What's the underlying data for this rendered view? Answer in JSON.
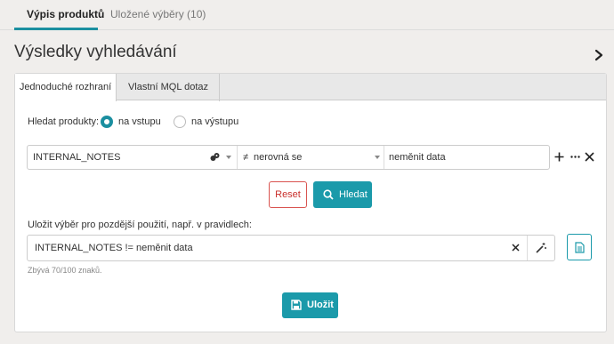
{
  "top_tabs": [
    {
      "label": "Výpis produktů",
      "active": true
    },
    {
      "label": "Uložené výběry (10)",
      "active": false
    }
  ],
  "page": {
    "title": "Výsledky vyhledávání"
  },
  "inner_tabs": [
    {
      "label": "Jednoduché rozhraní",
      "active": true
    },
    {
      "label": "Vlastní MQL dotaz",
      "active": false
    }
  ],
  "search_for": {
    "label": "Hledat produkty:",
    "options": [
      {
        "label": "na vstupu",
        "selected": true
      },
      {
        "label": "na výstupu",
        "selected": false
      }
    ]
  },
  "filter": {
    "field": "INTERNAL_NOTES",
    "operator_symbol": "≠",
    "operator": "nerovná se",
    "value": "neměnit data"
  },
  "buttons": {
    "reset": "Reset",
    "search": "Hledat",
    "save": "Uložit"
  },
  "save_selection": {
    "label": "Uložit výběr pro pozdější použití, např. v pravidlech:",
    "value": "INTERNAL_NOTES != neměnit data",
    "hint": "Zbývá 70/100 znaků."
  },
  "icons": [
    "chevron-right-icon",
    "filter-type-icon",
    "plus-icon",
    "more-icon",
    "close-icon",
    "search-icon",
    "clear-icon",
    "magic-wand-icon",
    "document-icon",
    "floppy-disk-icon"
  ],
  "colors": {
    "accent": "#1b9aaa",
    "danger": "#d9534f"
  }
}
